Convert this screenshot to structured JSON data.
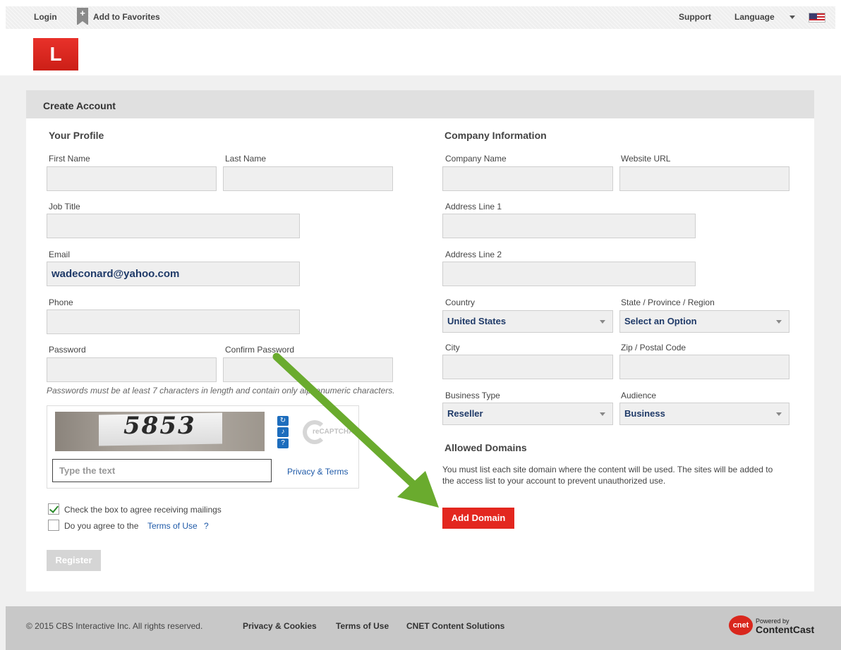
{
  "topbar": {
    "login": "Login",
    "add_favorites": "Add to Favorites",
    "support": "Support",
    "language": "Language"
  },
  "logo": {
    "letter": "L"
  },
  "panel": {
    "title": "Create Account"
  },
  "profile": {
    "title": "Your Profile",
    "first_name_label": "First Name",
    "last_name_label": "Last Name",
    "job_title_label": "Job Title",
    "email_label": "Email",
    "email_value": "wadeconard@yahoo.com",
    "phone_label": "Phone",
    "password_label": "Password",
    "confirm_password_label": "Confirm Password",
    "password_hint": "Passwords must be at least 7 characters in length and contain only alphanumeric characters."
  },
  "captcha": {
    "code": "5853",
    "input_placeholder": "Type the text",
    "privacy_terms": "Privacy & Terms",
    "logo_text": "reCAPTCHA"
  },
  "agreements": {
    "mailings_label": "Check the box to agree receiving mailings",
    "mailings_checked": true,
    "terms_prefix": "Do you agree to the",
    "terms_link": "Terms of Use",
    "terms_suffix": "?",
    "terms_checked": false
  },
  "register_label": "Register",
  "company": {
    "title": "Company Information",
    "company_name_label": "Company Name",
    "website_label": "Website URL",
    "address1_label": "Address Line 1",
    "address2_label": "Address Line 2",
    "country_label": "Country",
    "country_value": "United States",
    "state_label": "State / Province / Region",
    "state_value": "Select an Option",
    "city_label": "City",
    "zip_label": "Zip / Postal Code",
    "business_type_label": "Business Type",
    "business_type_value": "Reseller",
    "audience_label": "Audience",
    "audience_value": "Business"
  },
  "domains": {
    "title": "Allowed Domains",
    "description_line1": "You must list each site domain where the content will be used. The sites will be added to",
    "description_line2": "the access list to your account to prevent unauthorized use.",
    "add_label": "Add Domain"
  },
  "footer": {
    "copyright": "© 2015 CBS Interactive Inc. All rights reserved.",
    "privacy": "Privacy & Cookies",
    "terms": "Terms of Use",
    "solutions": "CNET Content Solutions",
    "badge": "cnet",
    "powered_by": "Powered by",
    "brand": "ContentCast"
  },
  "colors": {
    "accent_red": "#e3271f",
    "link_blue": "#1f5aa8",
    "annotation_arrow": "#6aab2e"
  }
}
